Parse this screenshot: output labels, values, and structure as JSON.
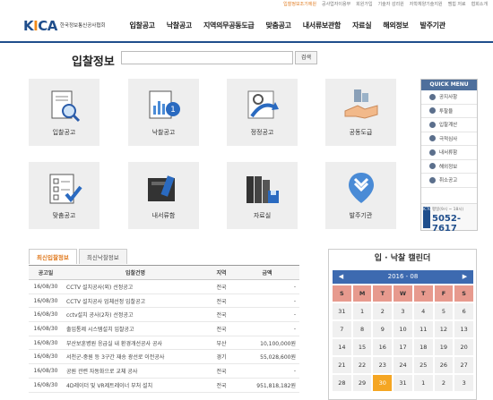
{
  "topbar": [
    "입찰정보조기에원",
    "공사업자이용무",
    "회원가입",
    "기술자 감리원",
    "자학체양기술지원",
    "멤힙 저료",
    "협회소개"
  ],
  "logo": {
    "mark": "KICA",
    "subtitle": "한국정보통신공사협회"
  },
  "gnb": [
    "입찰공고",
    "낙찰공고",
    "지역의무공동도급",
    "맞춤공고",
    "내서류보관함",
    "자료실",
    "해외정보",
    "발주기관"
  ],
  "section_title": "입찰정보",
  "search": {
    "value": "",
    "button": "검색"
  },
  "tiles": [
    {
      "label": "입찰공고",
      "icon": "magnifier-document-icon"
    },
    {
      "label": "낙찰공고",
      "icon": "award-chart-icon"
    },
    {
      "label": "정정공고",
      "icon": "refresh-arrow-icon"
    },
    {
      "label": "공동도급",
      "icon": "handshake-icon"
    },
    {
      "label": "맞춤공고",
      "icon": "checklist-icon"
    },
    {
      "label": "내서류함",
      "icon": "file-folder-icon"
    },
    {
      "label": "자료실",
      "icon": "binders-icon"
    },
    {
      "label": "발주기관",
      "icon": "location-pin-icon"
    }
  ],
  "quick_menu": {
    "title": "QUICK MENU",
    "items": [
      "공지사항",
      "투찰율",
      "입찰계산",
      "극적심사",
      "내서류함",
      "해외정보",
      "취소공고"
    ],
    "phone_small": "평일(9시 ~ 18시)",
    "phone": "5052-7617",
    "phone_tag": "ICTO"
  },
  "tabs": [
    "최신입찰정보",
    "최신낙찰정보"
  ],
  "bid_table": {
    "headers": [
      "공고일",
      "입찰건명",
      "지역",
      "금액"
    ],
    "rows": [
      [
        "16/08/30",
        "CCTV 설치공사(외) 선정공고",
        "전국",
        "-"
      ],
      [
        "16/08/30",
        "CCTV 설치공사 업체선정 입찰공고",
        "전국",
        "-"
      ],
      [
        "16/08/30",
        "cctv설치 공사(2차) 선정공고",
        "전국",
        "-"
      ],
      [
        "16/08/30",
        "출입통제 시스템설치 입찰공고",
        "전국",
        "-"
      ],
      [
        "16/08/30",
        "부산보훈병원 응급실 내 환경개선공사 공사",
        "부산",
        "10,100,000원"
      ],
      [
        "16/08/30",
        "서천군-중원 등 3구간 재송 광선로 이전공사",
        "경기",
        "55,028,600원"
      ],
      [
        "16/08/30",
        "공원 관련 자동화으로 교체 공사",
        "전국",
        "-"
      ],
      [
        "16/08/30",
        "4D레이더 및 VR제트레이너 부처 설치",
        "전국",
        "951,818,182원"
      ]
    ]
  },
  "calendar": {
    "title": "입 · 낙찰 캘린더",
    "month": "2016 - 08",
    "prev": "◀",
    "next": "▶",
    "weekdays": [
      "S",
      "M",
      "T",
      "W",
      "T",
      "F",
      "S"
    ],
    "days": [
      "31",
      "1",
      "2",
      "3",
      "4",
      "5",
      "6",
      "7",
      "8",
      "9",
      "10",
      "11",
      "12",
      "13",
      "14",
      "15",
      "16",
      "17",
      "18",
      "19",
      "20",
      "21",
      "22",
      "23",
      "24",
      "25",
      "26",
      "27",
      "28",
      "29",
      "30",
      "31",
      "1",
      "2",
      "3"
    ],
    "today": "30",
    "colors": {
      "header_bar": "#3d6ab0",
      "weekday_bg": "#e79a8e",
      "today_bg": "#f5a623"
    }
  }
}
